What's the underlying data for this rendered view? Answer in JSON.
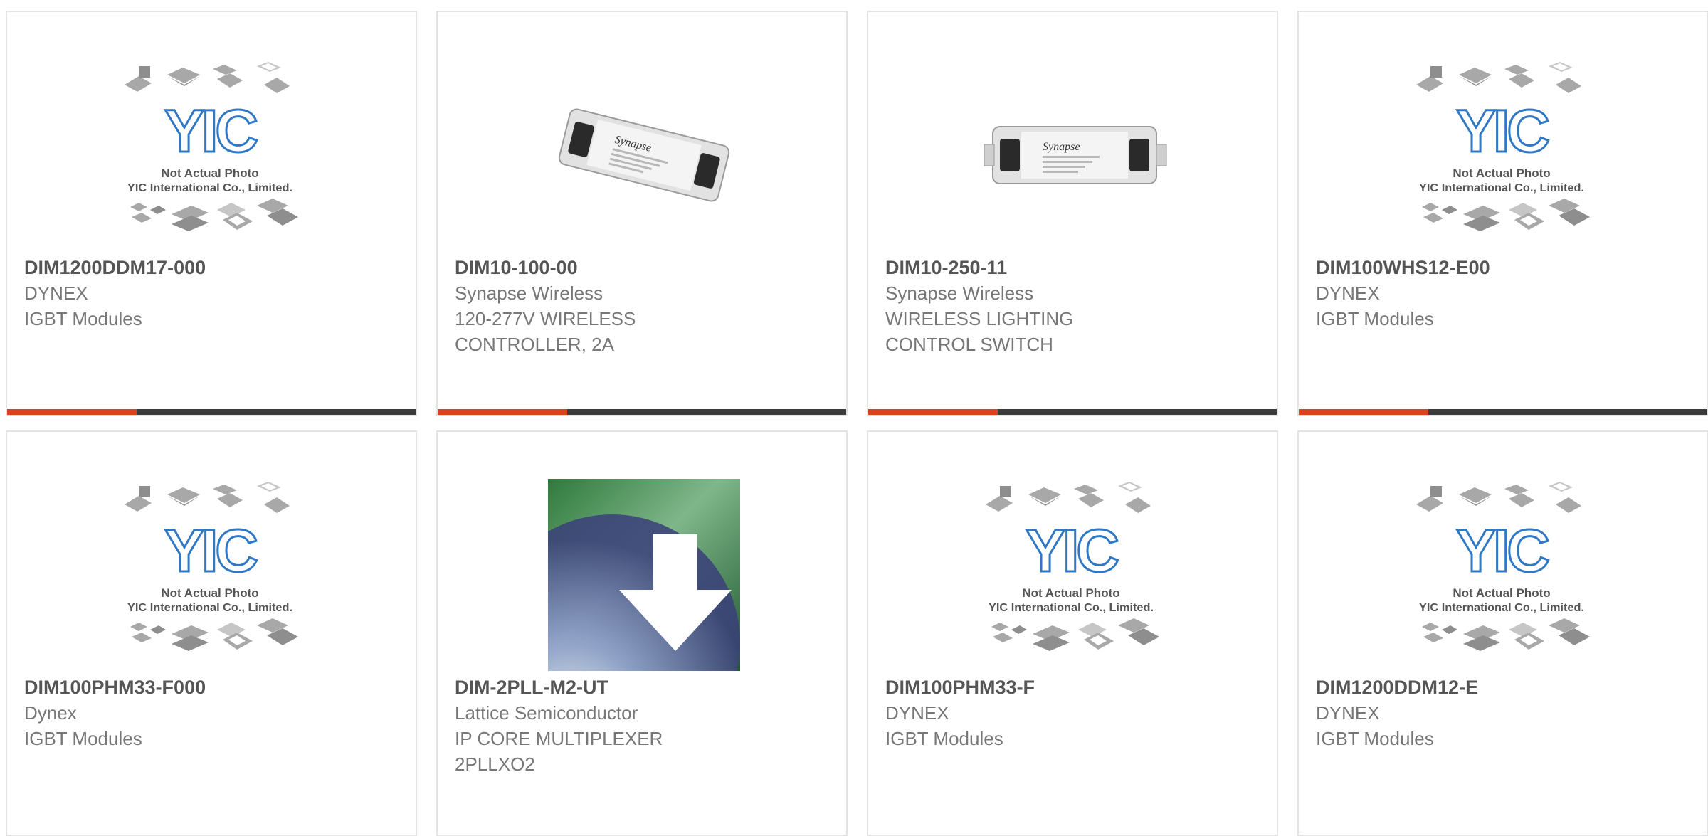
{
  "colors": {
    "accent": "#e0401a",
    "bar": "#3c3c3c",
    "text_part": "#555555",
    "text": "#777777",
    "border": "#e4e4e4",
    "yic_blue": "#2f78c5"
  },
  "placeholder": {
    "line1": "Not Actual Photo",
    "line2": "YIC International Co., Limited.",
    "logo": "YIC"
  },
  "synapse_label": "Synapse",
  "products": [
    {
      "part": "DIM1200DDM17-000",
      "manufacturer": "DYNEX",
      "description": [
        "IGBT Modules"
      ],
      "image": "yic-placeholder",
      "has_bar": true
    },
    {
      "part": "DIM10-100-00",
      "manufacturer": "Synapse Wireless",
      "description": [
        "120-277V WIRELESS",
        "CONTROLLER, 2A"
      ],
      "image": "synapse-controller-photo",
      "has_bar": true
    },
    {
      "part": "DIM10-250-11",
      "manufacturer": "Synapse Wireless",
      "description": [
        "WIRELESS LIGHTING",
        "CONTROL SWITCH"
      ],
      "image": "synapse-switch-photo",
      "has_bar": true
    },
    {
      "part": "DIM100WHS12-E00",
      "manufacturer": "DYNEX",
      "description": [
        "IGBT Modules"
      ],
      "image": "yic-placeholder",
      "has_bar": true
    },
    {
      "part": "DIM100PHM33-F000",
      "manufacturer": "Dynex",
      "description": [
        "IGBT Modules"
      ],
      "image": "yic-placeholder",
      "has_bar": false
    },
    {
      "part": "DIM-2PLL-M2-UT",
      "manufacturer": "Lattice Semiconductor",
      "description": [
        "IP CORE MULTIPLEXER",
        "2PLLXO2"
      ],
      "image": "software-download-icon",
      "has_bar": false
    },
    {
      "part": "DIM100PHM33-F",
      "manufacturer": "DYNEX",
      "description": [
        "IGBT Modules"
      ],
      "image": "yic-placeholder",
      "has_bar": false
    },
    {
      "part": "DIM1200DDM12-E",
      "manufacturer": "DYNEX",
      "description": [
        "IGBT Modules"
      ],
      "image": "yic-placeholder",
      "has_bar": false
    }
  ]
}
